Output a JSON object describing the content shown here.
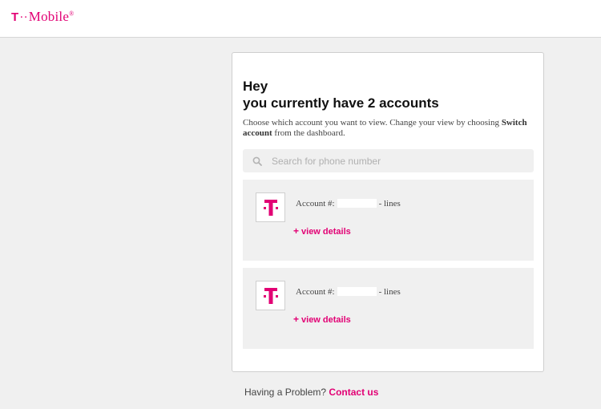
{
  "header": {
    "logo_t": "T",
    "logo_dots": "··",
    "logo_word": "Mobile",
    "logo_reg": "®",
    "brand_color": "#e20074"
  },
  "card": {
    "greeting": "Hey",
    "headline": "you currently have 2 accounts",
    "desc_prefix": "Choose which account you want to view. Change your view by choosing ",
    "desc_bold": "Switch account",
    "desc_suffix": " from the dashboard.",
    "search": {
      "icon": "search-icon",
      "placeholder": "Search for phone number",
      "value": ""
    },
    "accounts": [
      {
        "label": "Account #:",
        "number": "",
        "suffix": "- lines",
        "plus": "+",
        "link": "view details"
      },
      {
        "label": "Account #:",
        "number": "",
        "suffix": "- lines",
        "plus": "+",
        "link": "view details"
      }
    ]
  },
  "footer": {
    "text": "Having a Problem?",
    "link": "Contact us"
  }
}
